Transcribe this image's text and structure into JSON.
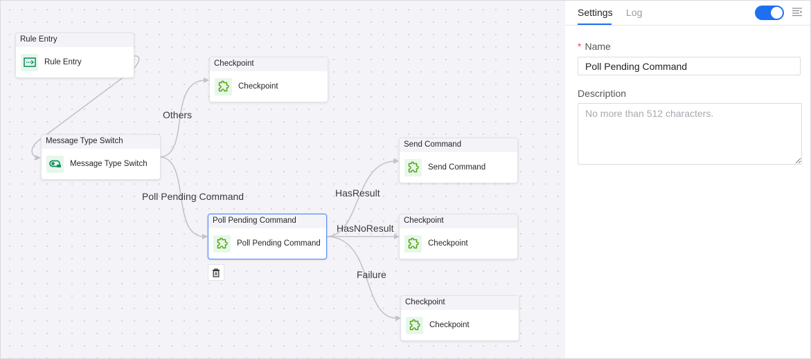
{
  "canvas": {
    "nodes": [
      {
        "id": "rule-entry",
        "type_label": "Rule Entry",
        "name": "Rule Entry",
        "icon": "rule-entry-icon",
        "selected": false
      },
      {
        "id": "checkpoint-1",
        "type_label": "Checkpoint",
        "name": "Checkpoint",
        "icon": "puzzle-icon",
        "selected": false
      },
      {
        "id": "message-type-switch",
        "type_label": "Message Type Switch",
        "name": "Message Type Switch",
        "icon": "switch-icon",
        "selected": false
      },
      {
        "id": "send-command",
        "type_label": "Send Command",
        "name": "Send Command",
        "icon": "puzzle-icon",
        "selected": false
      },
      {
        "id": "poll-pending-command",
        "type_label": "Poll Pending Command",
        "name": "Poll Pending Command",
        "icon": "puzzle-icon",
        "selected": true
      },
      {
        "id": "checkpoint-2",
        "type_label": "Checkpoint",
        "name": "Checkpoint",
        "icon": "puzzle-icon",
        "selected": false
      },
      {
        "id": "checkpoint-3",
        "type_label": "Checkpoint",
        "name": "Checkpoint",
        "icon": "puzzle-icon",
        "selected": false
      }
    ],
    "edges": [
      {
        "from": "rule-entry",
        "to": "message-type-switch",
        "label": ""
      },
      {
        "from": "message-type-switch",
        "to": "checkpoint-1",
        "label": "Others"
      },
      {
        "from": "message-type-switch",
        "to": "poll-pending-command",
        "label": "Poll Pending Command"
      },
      {
        "from": "poll-pending-command",
        "to": "send-command",
        "label": "HasResult"
      },
      {
        "from": "poll-pending-command",
        "to": "checkpoint-2",
        "label": "HasNoResult"
      },
      {
        "from": "poll-pending-command",
        "to": "checkpoint-3",
        "label": "Failure"
      }
    ],
    "delete_button_icon": "trash-icon"
  },
  "panel": {
    "tabs": [
      {
        "label": "Settings",
        "active": true
      },
      {
        "label": "Log",
        "active": false
      }
    ],
    "enabled_toggle": true,
    "collapse_icon": "collapse-panel-icon",
    "name_field": {
      "label": "Name",
      "required": true,
      "value": "Poll Pending Command"
    },
    "description_field": {
      "label": "Description",
      "value": "",
      "placeholder": "No more than 512 characters."
    }
  },
  "colors": {
    "accent": "#1e6ff2",
    "selected_border": "#5b8ff9",
    "icon_bg": "#e6f7ea",
    "rule_entry_icon": "#12906a",
    "puzzle_icon": "#5aa211",
    "required_star": "#e34d59"
  }
}
